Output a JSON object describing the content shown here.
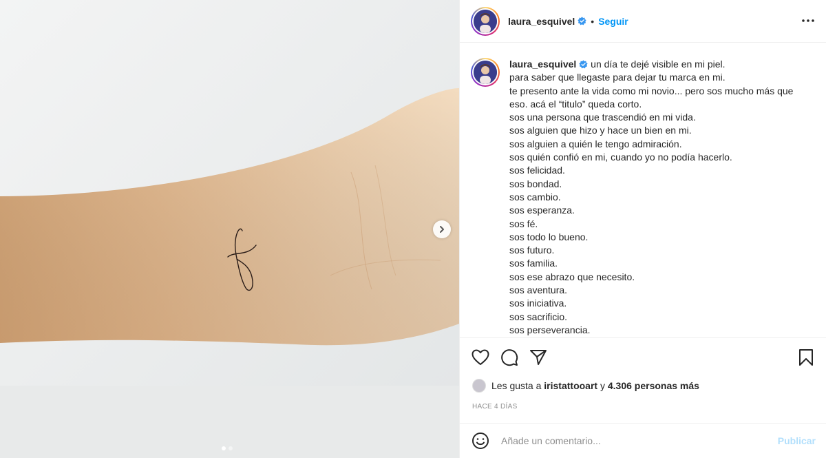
{
  "post": {
    "username": "laura_esquivel",
    "separator": "•",
    "follow_label": "Seguir",
    "caption_lines": [
      "un día te dejé visible en mi piel.",
      "para saber que llegaste para dejar tu marca en mi.",
      "te presento ante la vida como mi novio... pero sos mucho más que",
      "eso. acá el “titulo” queda corto.",
      "sos una persona que trascendió en mi vida.",
      "sos alguien que hizo y hace un bien en mi.",
      "sos alguien a quién le tengo admiración.",
      "sos quién confió en mi, cuando yo no podía hacerlo.",
      "sos felicidad.",
      "sos bondad.",
      "sos cambio.",
      "sos esperanza.",
      "sos fé.",
      "sos todo lo bueno.",
      "sos futuro.",
      "sos familia.",
      "sos ese abrazo que necesito.",
      "sos aventura.",
      "sos iniciativa.",
      "sos sacrificio.",
      "sos perseverancia."
    ],
    "likes": {
      "prefix": "Les gusta a",
      "liker": "iristattooart",
      "connector": "y",
      "others": "4.306 personas más"
    },
    "date": "HACE 4 DÍAS",
    "comment": {
      "placeholder": "Añade un comentario...",
      "publish_label": "Publicar"
    }
  },
  "carousel": {
    "total_slides": 2,
    "active_slide": 1
  },
  "colors": {
    "accent_blue": "#0095f6",
    "publish_disabled": "#b2dffc",
    "muted": "#8e8e8e",
    "text": "#262626"
  },
  "icons": {
    "more": "more-options-icon",
    "like": "heart-icon",
    "comment": "comment-bubble-icon",
    "share": "paper-plane-icon",
    "save": "bookmark-icon",
    "emoji": "smiley-icon",
    "next": "chevron-right-icon",
    "verified": "verified-badge-icon"
  }
}
